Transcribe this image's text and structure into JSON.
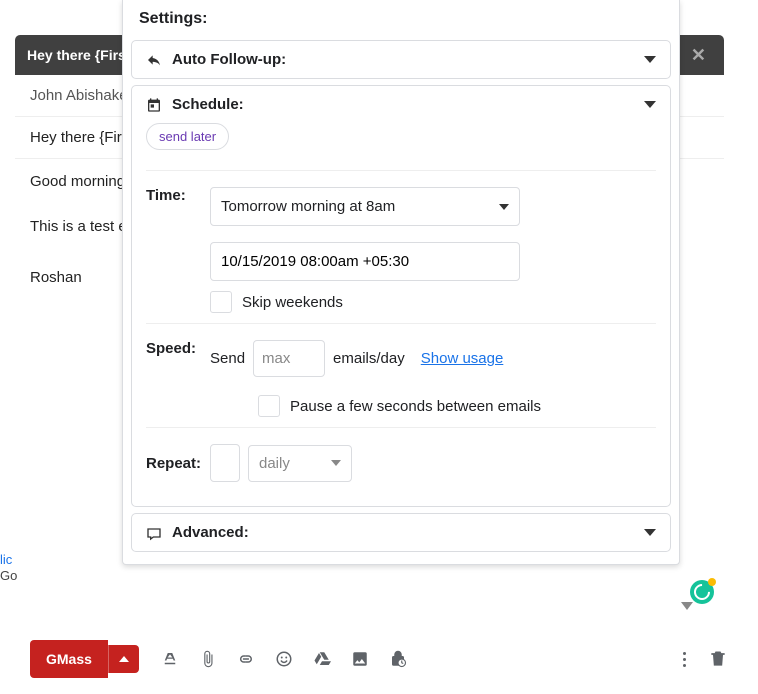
{
  "compose": {
    "subject_header": "Hey there {FirstName}",
    "to": "John Abishake",
    "subject": "Hey there {FirstName}",
    "body1": "Good morning",
    "body2": "This is a test email.",
    "signature": "Roshan"
  },
  "settings": {
    "title": "Settings:",
    "auto_followup": {
      "label": "Auto Follow-up:"
    },
    "schedule": {
      "label": "Schedule:",
      "send_later": "send later",
      "time_label": "Time:",
      "time_preset": "Tomorrow morning at 8am",
      "time_value": "10/15/2019 08:00am +05:30",
      "skip_weekends": "Skip weekends",
      "speed_label": "Speed:",
      "speed_send": "Send",
      "speed_placeholder": "max",
      "speed_suffix": "emails/day",
      "show_usage": "Show usage",
      "pause_label": "Pause a few seconds between emails",
      "repeat_label": "Repeat:",
      "repeat_interval": "daily"
    },
    "advanced": {
      "label": "Advanced:"
    }
  },
  "toolbar": {
    "gmass": "GMass"
  }
}
